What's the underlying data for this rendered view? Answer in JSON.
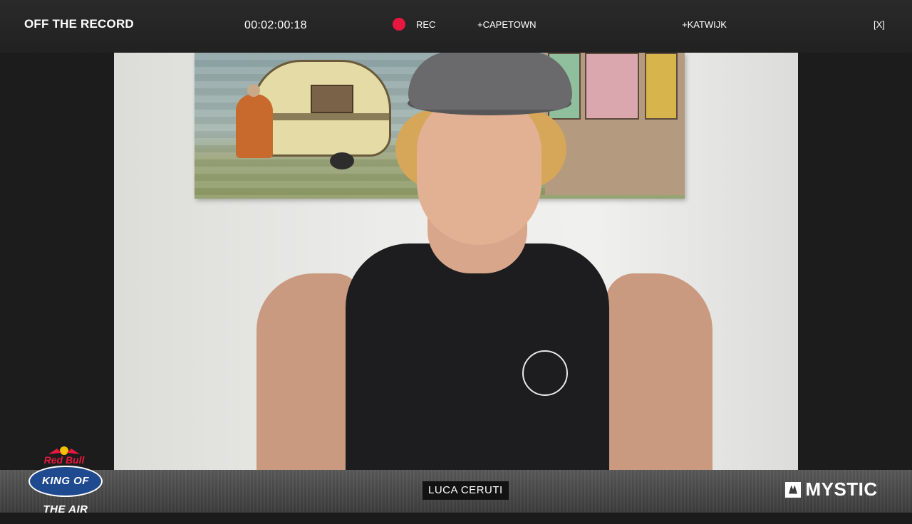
{
  "header": {
    "show_title": "OFF THE RECORD",
    "timecode": "00:02:00:18",
    "rec_label": "REC",
    "location_1": "+CAPETOWN",
    "location_2": "+KATWIJK",
    "close_label": "[X]"
  },
  "lower_third": {
    "name": "LUCA CERUTI"
  },
  "branding": {
    "left_logo_brand": "Red Bull",
    "left_logo_event": "KING OF THE AIR",
    "right_logo": "MYSTIC"
  },
  "colors": {
    "rec": "#e8173f",
    "bar": "#232323"
  },
  "icons": {
    "rec": "record-dot-icon",
    "close": "close-icon",
    "mystic": "mystic-mark-icon"
  }
}
